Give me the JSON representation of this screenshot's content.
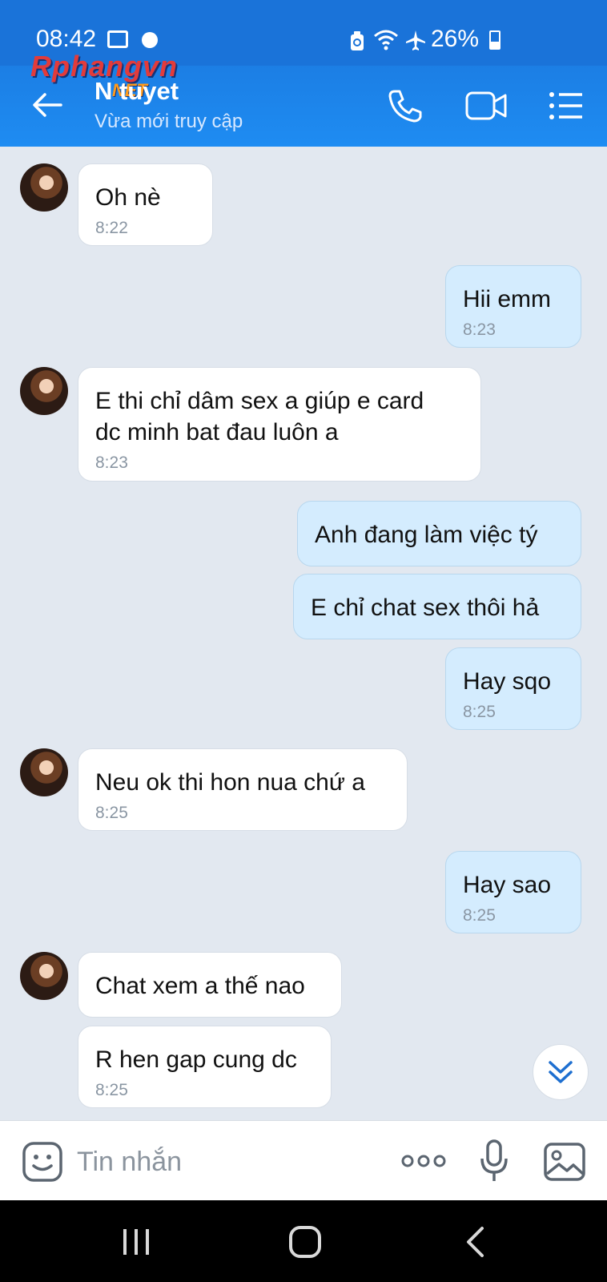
{
  "status_bar": {
    "time": "08:42",
    "battery": "26%"
  },
  "watermark": {
    "brand": "Rphangvn",
    "suffix": "NET"
  },
  "header": {
    "title": "N  tuyet",
    "subtitle": "Vừa mới truy cập"
  },
  "messages": [
    {
      "side": "in",
      "lines": [
        "Oh nè"
      ],
      "time": "8:22"
    },
    {
      "side": "out",
      "lines": [
        "Hii emm"
      ],
      "time": "8:23"
    },
    {
      "side": "in",
      "lines": [
        "E thi chỉ dâm sex a giúp e card",
        "dc minh bat đau luôn a"
      ],
      "time": "8:23"
    },
    {
      "side": "out",
      "lines": [
        "Anh đang làm việc tý"
      ],
      "time": ""
    },
    {
      "side": "out",
      "lines": [
        "E chỉ chat sex thôi hả"
      ],
      "time": ""
    },
    {
      "side": "out",
      "lines": [
        "Hay sqo"
      ],
      "time": "8:25"
    },
    {
      "side": "in",
      "lines": [
        "Neu ok thi hon nua chứ a"
      ],
      "time": "8:25"
    },
    {
      "side": "out",
      "lines": [
        "Hay sao"
      ],
      "time": "8:25"
    },
    {
      "side": "in",
      "lines": [
        "Chat xem a thế nao"
      ],
      "time": ""
    },
    {
      "side": "in",
      "lines": [
        "R hen gap cung dc"
      ],
      "time": "8:25"
    }
  ],
  "input": {
    "placeholder": "Tin nhắn"
  },
  "colors": {
    "header": "#1e8cf2",
    "incoming": "#ffffff",
    "outgoing": "#d4ecfe",
    "background": "#e2e8f0"
  }
}
